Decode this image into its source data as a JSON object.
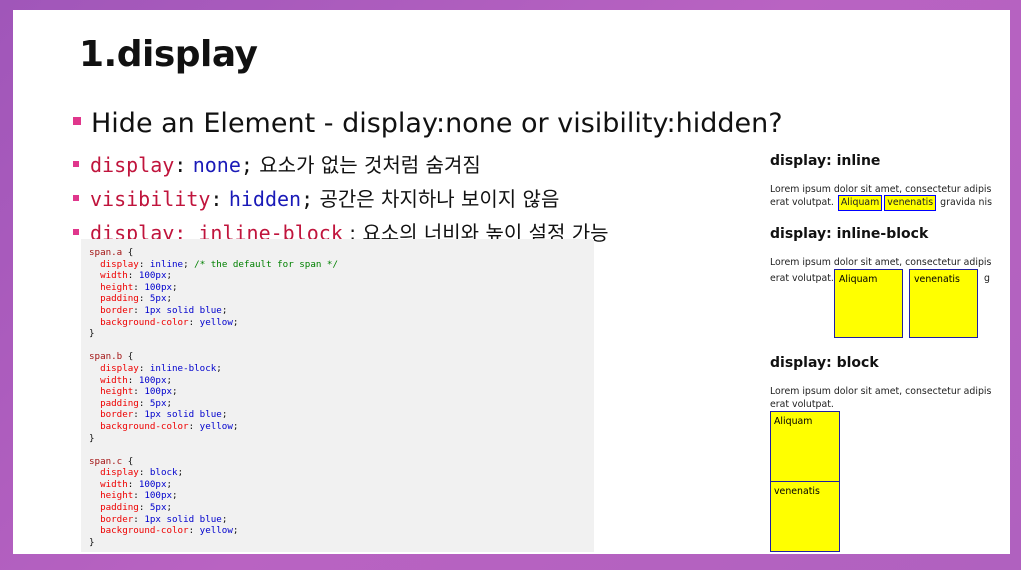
{
  "title": "1.display",
  "main_bullet": "Hide an Element - display:none or visibility:hidden?",
  "bullets": [
    {
      "prop": "display",
      "colon": ":",
      "value": "none",
      "semicolon": ";",
      "desc": "요소가 없는 것처럼 숨겨짐"
    },
    {
      "prop": "visibility",
      "colon": ":",
      "value": "hidden",
      "semicolon": ";",
      "desc": "공간은 차지하나 보이지 않음"
    },
    {
      "code": "display: inline-block",
      "desc": ": 요소의 너비와 높이 설정 가능"
    }
  ],
  "code": {
    "blocks": [
      {
        "selector": "span.a",
        "lines": [
          {
            "prop": "display",
            "val": "inline",
            "comment": "/* the default for span */"
          },
          {
            "prop": "width",
            "val": "100px"
          },
          {
            "prop": "height",
            "val": "100px"
          },
          {
            "prop": "padding",
            "val": "5px"
          },
          {
            "prop": "border",
            "val": "1px solid blue"
          },
          {
            "prop": "background-color",
            "val": "yellow"
          }
        ]
      },
      {
        "selector": "span.b",
        "lines": [
          {
            "prop": "display",
            "val": "inline-block"
          },
          {
            "prop": "width",
            "val": "100px"
          },
          {
            "prop": "height",
            "val": "100px"
          },
          {
            "prop": "padding",
            "val": "5px"
          },
          {
            "prop": "border",
            "val": "1px solid blue"
          },
          {
            "prop": "background-color",
            "val": "yellow"
          }
        ]
      },
      {
        "selector": "span.c",
        "lines": [
          {
            "prop": "display",
            "val": "block"
          },
          {
            "prop": "width",
            "val": "100px"
          },
          {
            "prop": "height",
            "val": "100px"
          },
          {
            "prop": "padding",
            "val": "5px"
          },
          {
            "prop": "border",
            "val": "1px solid blue"
          },
          {
            "prop": "background-color",
            "val": "yellow"
          }
        ]
      }
    ]
  },
  "demo": {
    "inline": {
      "heading": "display: inline",
      "line1": "Lorem ipsum dolor sit amet, consectetur adipis",
      "pre": "erat volutpat.",
      "box1": "Aliquam",
      "box2": "venenatis",
      "post": "gravida nis"
    },
    "inline_block": {
      "heading": "display: inline-block",
      "line1": "Lorem ipsum dolor sit amet, consectetur adipis",
      "pre": "erat volutpat.",
      "box1": "Aliquam",
      "box2": "venenatis",
      "post": "g"
    },
    "block": {
      "heading": "display: block",
      "line1": "Lorem ipsum dolor sit amet, consectetur adipis",
      "line2": "erat volutpat.",
      "box1": "Aliquam",
      "box2": "venenatis"
    }
  },
  "colors": {
    "background": "#b061bf",
    "bullet": "#e0368c",
    "property": "#c0143c",
    "value": "#1a1ab8",
    "box_fill": "#ffff00"
  }
}
